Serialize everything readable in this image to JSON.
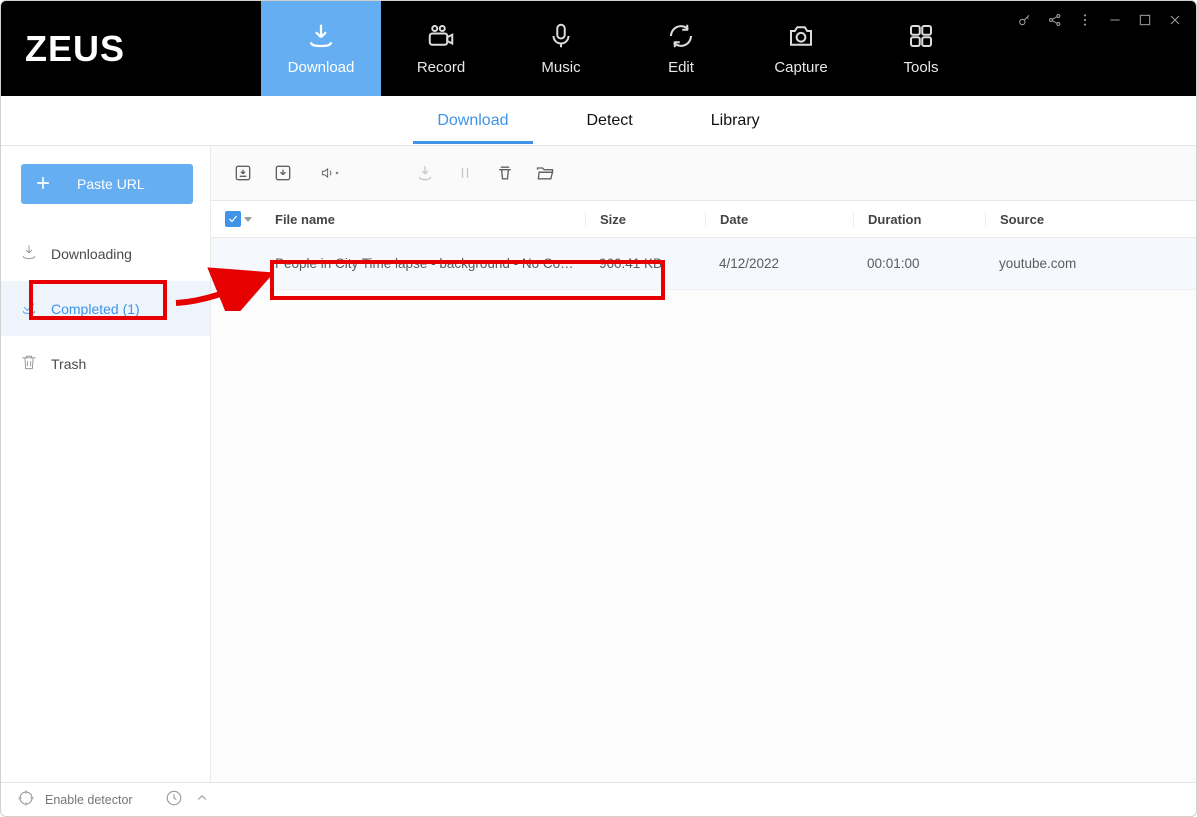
{
  "app": {
    "name": "ZEUS"
  },
  "topbar": {
    "tabs": [
      {
        "id": "download",
        "label": "Download"
      },
      {
        "id": "record",
        "label": "Record"
      },
      {
        "id": "music",
        "label": "Music"
      },
      {
        "id": "edit",
        "label": "Edit"
      },
      {
        "id": "capture",
        "label": "Capture"
      },
      {
        "id": "tools",
        "label": "Tools"
      }
    ],
    "active": "download"
  },
  "subtabs": {
    "items": [
      {
        "id": "download",
        "label": "Download"
      },
      {
        "id": "detect",
        "label": "Detect"
      },
      {
        "id": "library",
        "label": "Library"
      }
    ],
    "active": "download"
  },
  "sidebar": {
    "paste_label": "Paste URL",
    "items": {
      "downloading": "Downloading",
      "completed": "Completed (1)",
      "trash": "Trash"
    },
    "active": "completed"
  },
  "columns": {
    "file": "File name",
    "size": "Size",
    "date": "Date",
    "dur": "Duration",
    "src": "Source"
  },
  "rows": [
    {
      "file": "People in City Time lapse - background - No Copyr...",
      "size": "960.41 KB",
      "date": "4/12/2022",
      "dur": "00:01:00",
      "src": "youtube.com"
    }
  ],
  "footer": {
    "detector": "Enable detector"
  }
}
